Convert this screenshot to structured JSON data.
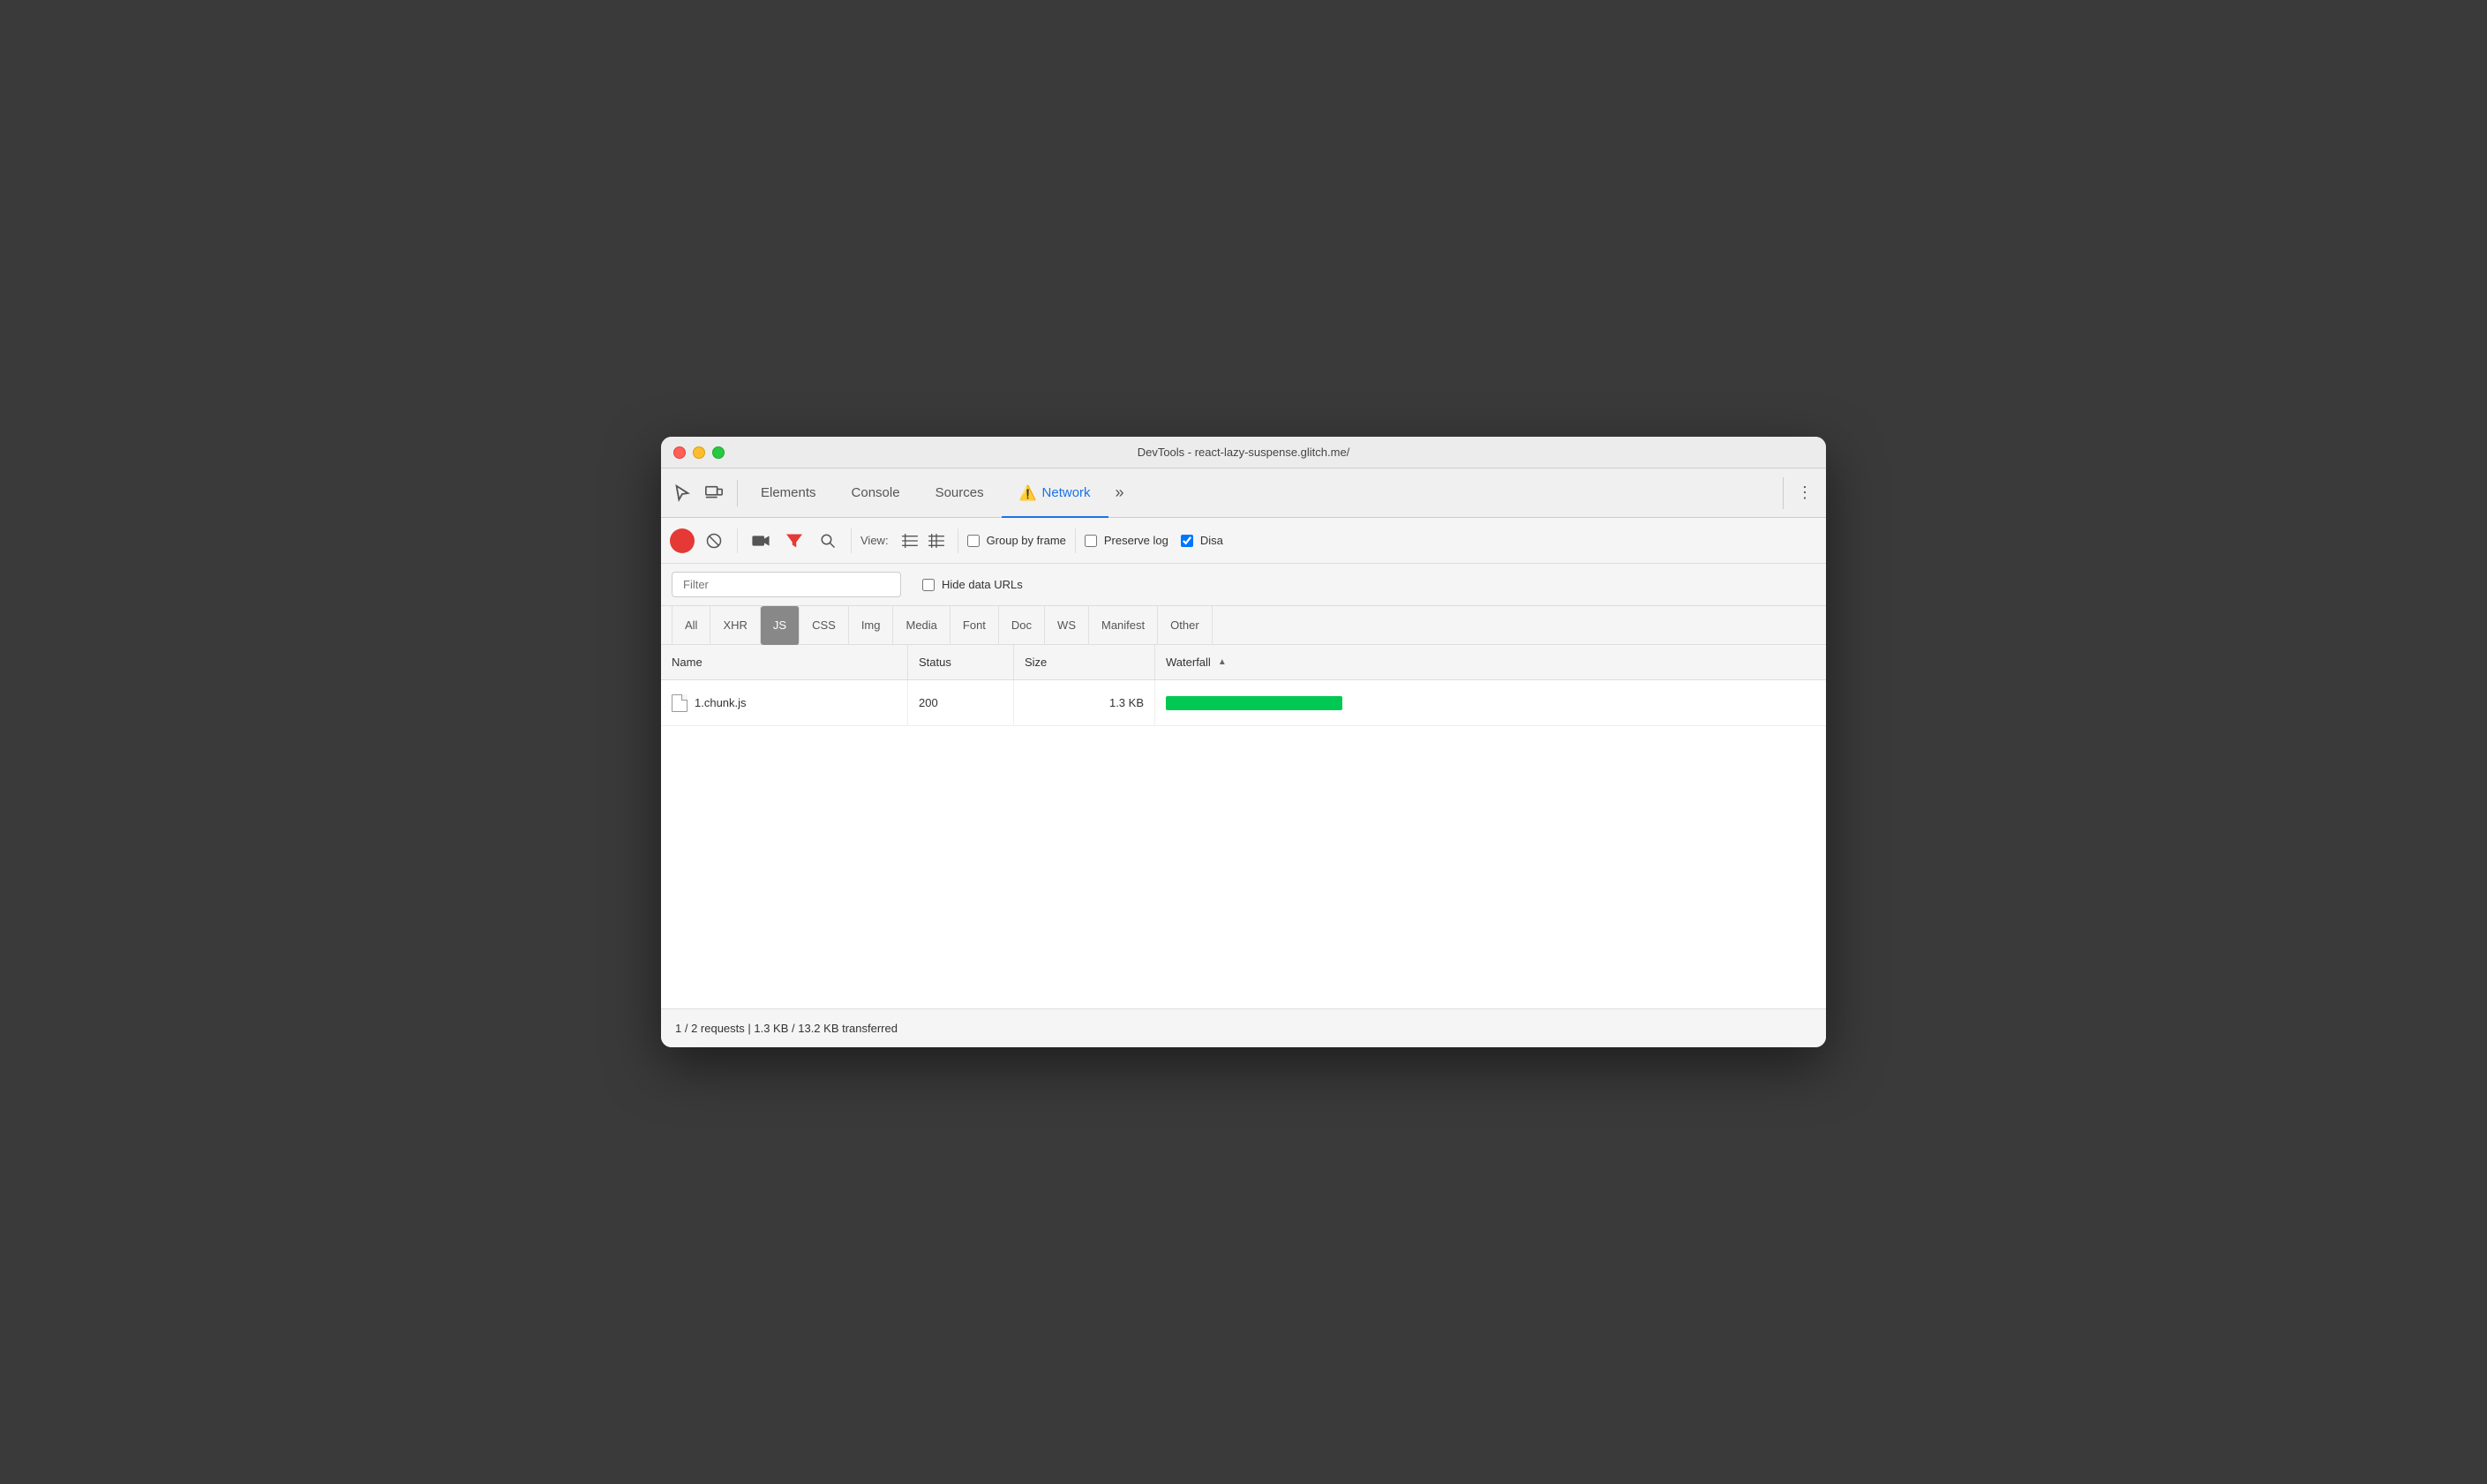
{
  "window": {
    "title": "DevTools - react-lazy-suspense.glitch.me/"
  },
  "tabs": {
    "items": [
      {
        "id": "elements",
        "label": "Elements",
        "active": false
      },
      {
        "id": "console",
        "label": "Console",
        "active": false
      },
      {
        "id": "sources",
        "label": "Sources",
        "active": false
      },
      {
        "id": "network",
        "label": "Network",
        "active": true,
        "warning": true
      },
      {
        "id": "overflow",
        "label": "»",
        "active": false
      }
    ]
  },
  "toolbar": {
    "view_label": "View:",
    "group_by_frame_label": "Group by frame",
    "preserve_log_label": "Preserve log",
    "disable_cache_label": "Disa"
  },
  "filter": {
    "placeholder": "Filter",
    "hide_data_urls_label": "Hide data URLs"
  },
  "filter_tabs": {
    "items": [
      {
        "id": "all",
        "label": "All",
        "active": false
      },
      {
        "id": "xhr",
        "label": "XHR",
        "active": false
      },
      {
        "id": "js",
        "label": "JS",
        "active": true
      },
      {
        "id": "css",
        "label": "CSS",
        "active": false
      },
      {
        "id": "img",
        "label": "Img",
        "active": false
      },
      {
        "id": "media",
        "label": "Media",
        "active": false
      },
      {
        "id": "font",
        "label": "Font",
        "active": false
      },
      {
        "id": "doc",
        "label": "Doc",
        "active": false
      },
      {
        "id": "ws",
        "label": "WS",
        "active": false
      },
      {
        "id": "manifest",
        "label": "Manifest",
        "active": false
      },
      {
        "id": "other",
        "label": "Other",
        "active": false
      }
    ]
  },
  "table": {
    "columns": [
      {
        "id": "name",
        "label": "Name"
      },
      {
        "id": "status",
        "label": "Status"
      },
      {
        "id": "size",
        "label": "Size"
      },
      {
        "id": "waterfall",
        "label": "Waterfall"
      }
    ],
    "rows": [
      {
        "name": "1.chunk.js",
        "status": "200",
        "size": "1.3 KB",
        "waterfall_width": 200
      }
    ]
  },
  "status_bar": {
    "text": "1 / 2 requests | 1.3 KB / 13.2 KB transferred"
  },
  "colors": {
    "active_tab": "#1a73e8",
    "record_red": "#e53935",
    "waterfall_green": "#00c853",
    "js_badge_bg": "#888",
    "js_badge_text": "#fff"
  }
}
